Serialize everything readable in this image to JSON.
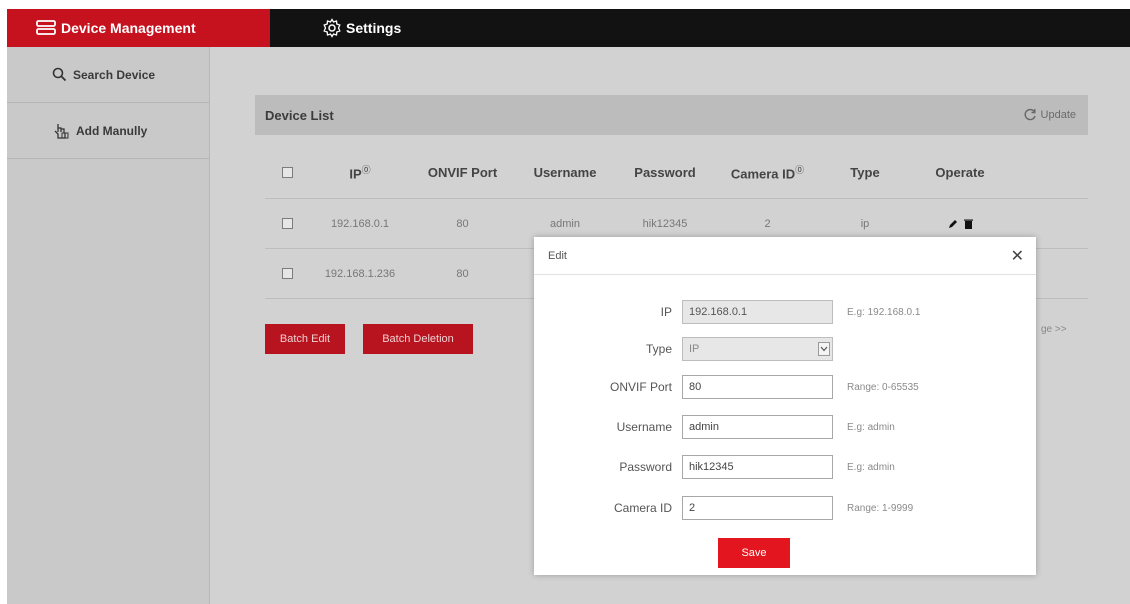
{
  "nav": {
    "device_management": "Device Management",
    "settings": "Settings"
  },
  "sidebar": {
    "items": [
      {
        "label": "Search Device",
        "icon": "search-icon"
      },
      {
        "label": "Add Manully",
        "icon": "hand-pointer-icon"
      }
    ]
  },
  "device_list": {
    "title": "Device List",
    "update_label": "Update",
    "columns": [
      "IP",
      "ONVIF Port",
      "Username",
      "Password",
      "Camera ID",
      "Type",
      "Operate"
    ],
    "info_marker": "⓪",
    "rows": [
      {
        "ip": "192.168.0.1",
        "port": "80",
        "username": "admin",
        "password": "hik12345",
        "camera_id": "2",
        "type": "ip"
      },
      {
        "ip": "192.168.1.236",
        "port": "80",
        "username": "",
        "password": "",
        "camera_id": "",
        "type": ""
      }
    ],
    "batch_edit": "Batch Edit",
    "batch_delete": "Batch Deletion",
    "page_nav": "ge >>"
  },
  "edit_dialog": {
    "title": "Edit",
    "fields": {
      "ip": {
        "label": "IP",
        "value": "192.168.0.1",
        "hint": "E.g: 192.168.0.1"
      },
      "type": {
        "label": "Type",
        "value": "IP"
      },
      "port": {
        "label": "ONVIF Port",
        "value": "80",
        "hint": "Range: 0-65535"
      },
      "username": {
        "label": "Username",
        "value": "admin",
        "hint": "E.g: admin"
      },
      "password": {
        "label": "Password",
        "value": "hik12345",
        "hint": "E.g: admin"
      },
      "camera_id": {
        "label": "Camera ID",
        "value": "2",
        "hint": "Range: 1-9999"
      }
    },
    "save_label": "Save"
  },
  "colors": {
    "brand_red": "#c5121e",
    "top_bar": "#121212",
    "save_red": "#e3151f"
  }
}
